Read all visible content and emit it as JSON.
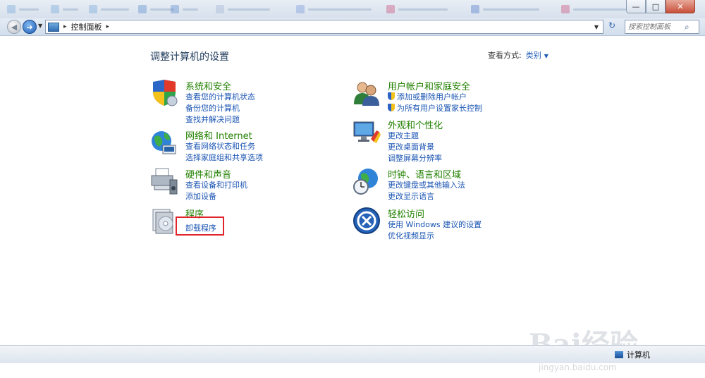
{
  "window": {
    "min_glyph": "—",
    "max_glyph": "□",
    "close_glyph": "✕"
  },
  "nav": {
    "breadcrumb_sep": "▸",
    "breadcrumb": "控制面板",
    "breadcrumb_end_sep": "▸",
    "search_placeholder": "搜索控制面板",
    "back_glyph": "◀",
    "forward_glyph": "➜",
    "dropdown_glyph": "▼",
    "refresh_glyph": "↻",
    "search_glyph": "⌕"
  },
  "page": {
    "title": "调整计算机的设置",
    "view_by_label": "查看方式:",
    "view_by_value": "类别",
    "view_by_arrow": "▼"
  },
  "categories": [
    {
      "title": "系统和安全",
      "icon": "shield-check-icon",
      "links": [
        "查看您的计算机状态",
        "备份您的计算机",
        "查找并解决问题"
      ]
    },
    {
      "title": "网络和 Internet",
      "icon": "network-globe-icon",
      "links": [
        "查看网络状态和任务",
        "选择家庭组和共享选项"
      ]
    },
    {
      "title": "硬件和声音",
      "icon": "printer-speaker-icon",
      "links": [
        "查看设备和打印机",
        "添加设备"
      ]
    },
    {
      "title": "程序",
      "icon": "programs-disc-icon",
      "links": [
        "卸载程序"
      ]
    },
    {
      "title": "用户帐户和家庭安全",
      "icon": "users-icon",
      "links": [
        "添加或删除用户帐户",
        "为所有用户设置家长控制"
      ]
    },
    {
      "title": "外观和个性化",
      "icon": "monitor-paint-icon",
      "links": [
        "更改主题",
        "更改桌面背景",
        "调整屏幕分辨率"
      ]
    },
    {
      "title": "时钟、语言和区域",
      "icon": "clock-globe-icon",
      "links": [
        "更改键盘或其他输入法",
        "更改显示语言"
      ]
    },
    {
      "title": "轻松访问",
      "icon": "ease-of-access-icon",
      "links": [
        "使用 Windows 建议的设置",
        "优化视频显示"
      ]
    }
  ],
  "status": {
    "computer": "计算机"
  },
  "watermark": {
    "brand": "Bai经验",
    "url": "jingyan.baidu.com"
  },
  "colors": {
    "category_title": "#218000",
    "link": "#1b55b3",
    "highlight": "#e0242b"
  }
}
